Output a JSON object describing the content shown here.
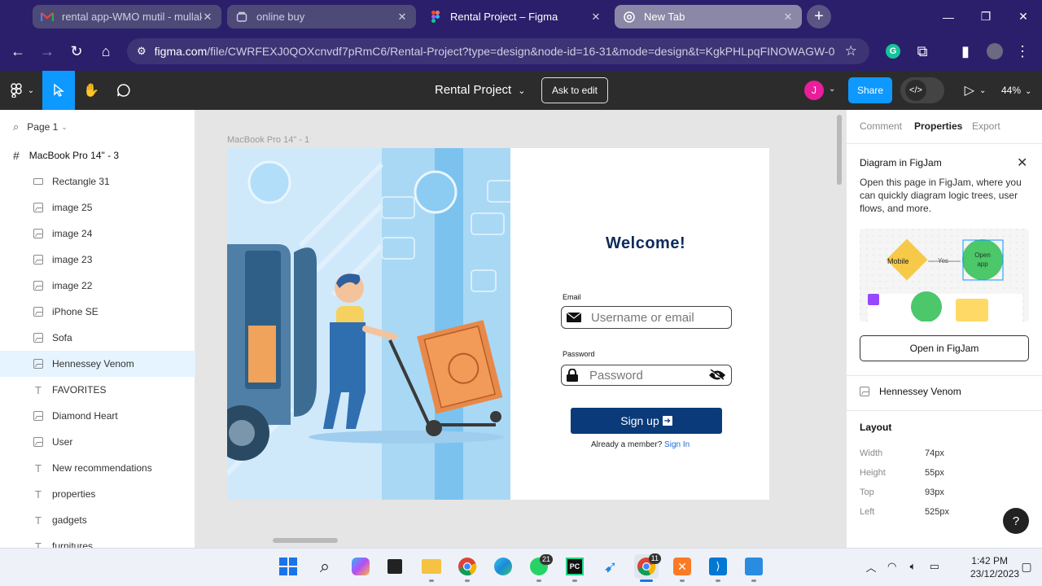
{
  "browser": {
    "tabs": [
      {
        "label": "rental app-WMO mutil - mullak",
        "icon": "gmail-icon",
        "state": "inactive"
      },
      {
        "label": "online buy",
        "icon": "page-icon",
        "state": "inactive"
      },
      {
        "label": "Rental Project – Figma",
        "icon": "figma-icon",
        "state": "active"
      },
      {
        "label": "New Tab",
        "icon": "chrome-icon",
        "state": "new"
      }
    ],
    "url_host": "figma.com",
    "url_path": "/file/CWRFEXJ0QOXcnvdf7pRmC6/Rental-Project?type=design&node-id=16-31&mode=design&t=KgkPHLpqFINOWAGW-0"
  },
  "figma": {
    "file_title": "Rental Project",
    "ask_to_edit": "Ask to edit",
    "share": "Share",
    "avatar_initial": "J",
    "zoom": "44%",
    "page_name": "Page 1",
    "frame_name": "MacBook Pro 14\" - 3",
    "layers": [
      {
        "name": "Rectangle 31",
        "type": "rect"
      },
      {
        "name": "image 25",
        "type": "image"
      },
      {
        "name": "image 24",
        "type": "image"
      },
      {
        "name": "image 23",
        "type": "image"
      },
      {
        "name": "image 22",
        "type": "image"
      },
      {
        "name": "iPhone SE",
        "type": "image"
      },
      {
        "name": "Sofa",
        "type": "image"
      },
      {
        "name": "Hennessey Venom",
        "type": "image",
        "selected": true
      },
      {
        "name": "FAVORITES",
        "type": "text"
      },
      {
        "name": "Diamond Heart",
        "type": "image"
      },
      {
        "name": "User",
        "type": "image"
      },
      {
        "name": "New recommendations",
        "type": "text"
      },
      {
        "name": "properties",
        "type": "text"
      },
      {
        "name": "gadgets",
        "type": "text"
      },
      {
        "name": "furnitures",
        "type": "text"
      }
    ],
    "canvas": {
      "frame_label": "MacBook Pro 14\" - 1",
      "welcome": "Welcome!",
      "email_label": "Email",
      "email_placeholder": "Username or email",
      "password_label": "Password",
      "password_placeholder": "Password",
      "signup_label": "Sign up",
      "member_text": "Already a member?",
      "signin_link": "Sign In"
    },
    "right_panel": {
      "tabs": [
        "Comment",
        "Properties",
        "Export"
      ],
      "active_tab": "Properties",
      "figjam_title": "Diagram in FigJam",
      "figjam_desc": "Open this page in FigJam, where you can quickly diagram logic trees, user flows, and more.",
      "preview": {
        "mobile": "Mobile",
        "yes": "Yes",
        "open_app": "Open app"
      },
      "open_in_figjam": "Open in FigJam",
      "selected_layer": "Hennessey Venom",
      "layout_title": "Layout",
      "layout": [
        {
          "key": "Width",
          "value": "74px"
        },
        {
          "key": "Height",
          "value": "55px"
        },
        {
          "key": "Top",
          "value": "93px"
        },
        {
          "key": "Left",
          "value": "525px"
        }
      ],
      "help": "?"
    }
  },
  "taskbar": {
    "badges": {
      "whatsapp": "21",
      "chrome": "11"
    },
    "time": "1:42 PM",
    "date": "23/12/2023"
  }
}
